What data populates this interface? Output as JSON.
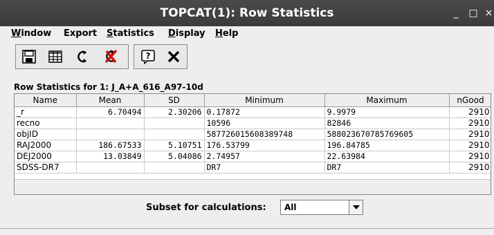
{
  "window": {
    "title": "TOPCAT(1): Row Statistics",
    "minimize_glyph": "_",
    "maximize_glyph": "□",
    "close_glyph": "×"
  },
  "menubar": {
    "items": [
      {
        "mnemonic": "W",
        "rest": "indow"
      },
      {
        "mnemonic": "",
        "rest": "Export"
      },
      {
        "mnemonic": "S",
        "rest": "tatistics"
      },
      {
        "mnemonic": "D",
        "rest": "isplay"
      },
      {
        "mnemonic": "H",
        "rest": "elp"
      }
    ]
  },
  "toolbar": {
    "icons": [
      "save-icon",
      "table-icon",
      "recalculate-icon",
      "cancel-calculation-icon",
      "help-icon",
      "close-icon"
    ]
  },
  "panel": {
    "title": "Row Statistics for 1: J_A+A_616_A97-10d"
  },
  "table": {
    "headers": [
      "Name",
      "Mean",
      "SD",
      "Minimum",
      "Maximum",
      "nGood"
    ],
    "rows": [
      {
        "name": "_r",
        "mean": "6.70494",
        "sd": "2.30206",
        "min": "0.17872",
        "max": "9.9979",
        "ngood": "2910"
      },
      {
        "name": "recno",
        "mean": "",
        "sd": "",
        "min": "10596",
        "max": "82846",
        "ngood": "2910"
      },
      {
        "name": "objID",
        "mean": "",
        "sd": "",
        "min": "587726015608389748",
        "max": "588023670785769605",
        "ngood": "2910"
      },
      {
        "name": "RAJ2000",
        "mean": "186.67533",
        "sd": "5.10751",
        "min": "176.53799",
        "max": "196.84785",
        "ngood": "2910"
      },
      {
        "name": "DEJ2000",
        "mean": "13.03849",
        "sd": "5.04086",
        "min": "2.74957",
        "max": "22.63984",
        "ngood": "2910"
      },
      {
        "name": "SDSS-DR7",
        "mean": "",
        "sd": "",
        "min": "DR7",
        "max": "DR7",
        "ngood": "2910"
      }
    ]
  },
  "subset": {
    "label": "Subset for calculations:",
    "selected": "All"
  },
  "colors": {
    "titlebar": "#3b3b3b",
    "cancel_icon_red": "#cc1111"
  }
}
